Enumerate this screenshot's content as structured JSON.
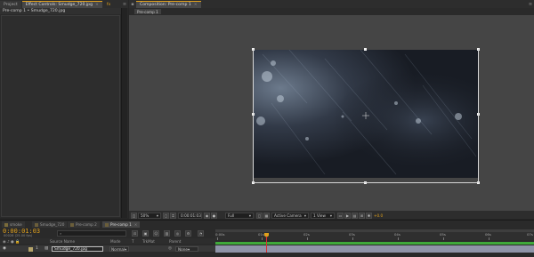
{
  "left_panel": {
    "tabs": [
      {
        "label": "Project",
        "active": false
      },
      {
        "label": "Effect Controls: Smudge_720.jpg",
        "active": true
      }
    ],
    "fx_badge": "fx",
    "subtitle": "Pre-comp 1 • Smudge_720.jpg"
  },
  "comp_panel": {
    "tab_label": "Composition: Pre-comp 1",
    "subtab": "Pre-comp 1",
    "viewer_controls": {
      "magnification": "50%",
      "timecode": "0:00:01:03",
      "resolution": "Full",
      "camera": "Active Camera",
      "views": "1 View",
      "exposure": "+0.0"
    }
  },
  "timeline": {
    "tabs": [
      {
        "label": "smoke",
        "color": "#7a6b3a",
        "active": false
      },
      {
        "label": "Smudge_720",
        "color": "#6b5e3a",
        "active": false
      },
      {
        "label": "Pre-comp 2",
        "color": "#6b5e3a",
        "active": false
      },
      {
        "label": "Pre-comp 1",
        "color": "#6b5e3a",
        "active": true
      }
    ],
    "current_time": "0:00:01:03",
    "fps_info": "00028 (25.00 fps)",
    "columns": [
      "Source Name",
      "Mode",
      "T",
      "TrkMat",
      "Parent"
    ],
    "ruler_ticks": [
      "0:00s",
      "01s",
      "02s",
      "03s",
      "04s",
      "05s",
      "06s",
      "07s"
    ],
    "layers": [
      {
        "number": "1",
        "name": "Smudge_720.jpg",
        "mode": "Normal",
        "parent": "None"
      }
    ],
    "accent_color": "#e0a01c"
  }
}
